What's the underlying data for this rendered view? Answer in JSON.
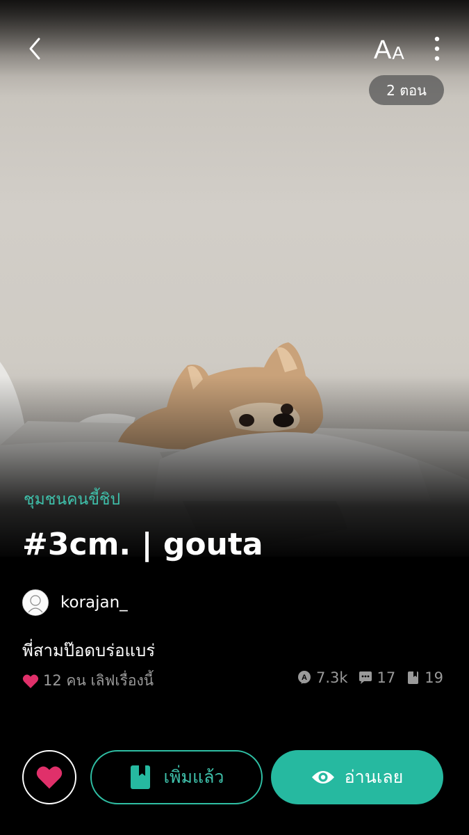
{
  "header": {
    "font_size_label_large": "A",
    "font_size_label_small": "A",
    "episode_count": "2 ตอน",
    "icons": [
      "back-arrow-icon",
      "font-size-icon",
      "more-vertical-icon"
    ]
  },
  "story": {
    "category": "ชุมชนคนขี้ชิป",
    "title": "#3cm. | gouta",
    "author": "korajan_",
    "description": "พี่สามป๊อดบร่อแบร่",
    "likes_text": "12 คน เลิฟเรื่องนี้",
    "views": "7.3k",
    "comments": "17",
    "chapters": "19"
  },
  "actions": {
    "add_label": "เพิ่มแล้ว",
    "read_label": "อ่านเลย"
  },
  "colors": {
    "accent": "#26b9a0",
    "category": "#3fc1ab",
    "heart": "#e0306a",
    "muted": "#9a9a9a"
  }
}
